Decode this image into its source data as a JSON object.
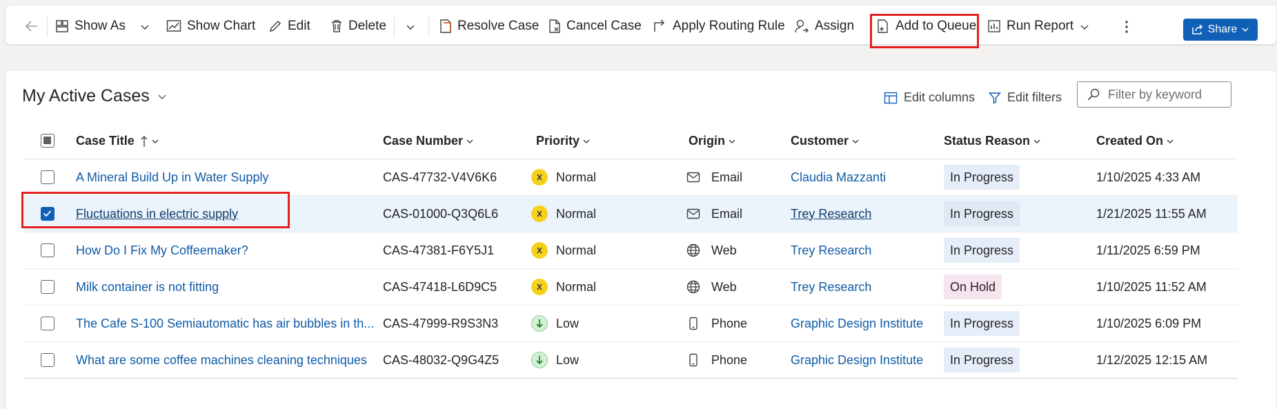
{
  "toolbar": {
    "show_as": "Show As",
    "show_chart": "Show Chart",
    "edit": "Edit",
    "delete": "Delete",
    "resolve_case": "Resolve Case",
    "cancel_case": "Cancel Case",
    "apply_routing_rule": "Apply Routing Rule",
    "assign": "Assign",
    "add_to_queue": "Add to Queue",
    "run_report": "Run Report",
    "share": "Share"
  },
  "view": {
    "title": "My Active Cases",
    "edit_columns": "Edit columns",
    "edit_filters": "Edit filters",
    "filter_placeholder": "Filter by keyword"
  },
  "columns": {
    "case_title": "Case Title",
    "case_number": "Case Number",
    "priority": "Priority",
    "origin": "Origin",
    "customer": "Customer",
    "status_reason": "Status Reason",
    "created_on": "Created On"
  },
  "rows": [
    {
      "title": "A Mineral Build Up in Water Supply",
      "number": "CAS-47732-V4V6K6",
      "priority": "Normal",
      "priority_icon": "close-icon",
      "origin": "Email",
      "origin_icon": "mail-icon",
      "customer": "Claudia Mazzanti",
      "status": "In Progress",
      "created": "1/10/2025 4:33 AM",
      "selected": false
    },
    {
      "title": "Fluctuations in electric supply",
      "number": "CAS-01000-Q3Q6L6",
      "priority": "Normal",
      "priority_icon": "close-icon",
      "origin": "Email",
      "origin_icon": "mail-icon",
      "customer": "Trey Research",
      "status": "In Progress",
      "created": "1/21/2025 11:55 AM",
      "selected": true
    },
    {
      "title": "How Do I Fix My Coffeemaker?",
      "number": "CAS-47381-F6Y5J1",
      "priority": "Normal",
      "priority_icon": "close-icon",
      "origin": "Web",
      "origin_icon": "globe-icon",
      "customer": "Trey Research",
      "status": "In Progress",
      "created": "1/11/2025 6:59 PM",
      "selected": false
    },
    {
      "title": "Milk container is not fitting",
      "number": "CAS-47418-L6D9C5",
      "priority": "Normal",
      "priority_icon": "close-icon",
      "origin": "Web",
      "origin_icon": "globe-icon",
      "customer": "Trey Research",
      "status": "On Hold",
      "created": "1/10/2025 11:52 AM",
      "selected": false
    },
    {
      "title": "The Cafe S-100 Semiautomatic has air bubbles in th...",
      "number": "CAS-47999-R9S3N3",
      "priority": "Low",
      "priority_icon": "arrow-down-icon",
      "origin": "Phone",
      "origin_icon": "phone-icon",
      "customer": "Graphic Design Institute",
      "status": "In Progress",
      "created": "1/10/2025 6:09 PM",
      "selected": false
    },
    {
      "title": "What are some coffee machines cleaning techniques",
      "number": "CAS-48032-Q9G4Z5",
      "priority": "Low",
      "priority_icon": "arrow-down-icon",
      "origin": "Phone",
      "origin_icon": "phone-icon",
      "customer": "Graphic Design Institute",
      "status": "In Progress",
      "created": "1/12/2025 12:15 AM",
      "selected": false
    }
  ],
  "colors": {
    "accent": "#1160b7",
    "highlight": "#e0201f",
    "link": "#0f5ba7",
    "selected_row": "#ebf3fc",
    "badge_in_progress": "#e5edf9",
    "badge_on_hold": "#f6e4ef",
    "priority_normal": "#f6d21c",
    "priority_low": "#d3efd6"
  }
}
